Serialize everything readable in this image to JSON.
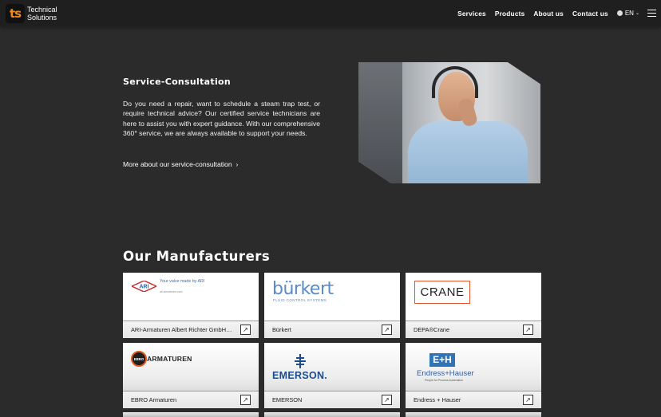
{
  "brand": {
    "mark": "ts",
    "line1": "Technical",
    "line2": "Solutions",
    "accent": "#f08a1c"
  },
  "nav": {
    "items": [
      "Services",
      "Products",
      "About us",
      "Contact us"
    ],
    "language": "EN",
    "globe_icon": "globe-icon",
    "menu_icon": "hamburger-icon"
  },
  "service": {
    "title": "Service-Consultation",
    "text": "Do you need a repair, want to schedule a steam trap test, or require technical advice? Our certified service technicians are here to assist you with expert guidance. With our comprehensive 360° service, we are always available to support your needs.",
    "link": "More about our service-consultation",
    "link_icon": "chevron-right-icon"
  },
  "manufacturers": {
    "title": "Our Manufacturers",
    "cards": [
      {
        "name": "ARI-Armaturen Albert Richter GmbH…",
        "logo_text": "ARI",
        "tagline": "Your valve made by ARI",
        "url": "ari-armaturen.com"
      },
      {
        "name": "Bürkert",
        "logo_text": "bürkert",
        "tagline": "FLUID CONTROL SYSTEMS"
      },
      {
        "name": "DEPA®Crane",
        "logo_text": "CRANE"
      },
      {
        "name": "EBRO Armaturen",
        "logo_text": "ARMATUREN",
        "mark": "EBRO"
      },
      {
        "name": "EMERSON",
        "logo_text": "EMERSON."
      },
      {
        "name": "Endress + Hauser",
        "logo_text": "Endress+Hauser",
        "mark": "E+H",
        "tagline": "People for Process Automation"
      }
    ],
    "link_icon": "arrow-up-right-icon"
  }
}
